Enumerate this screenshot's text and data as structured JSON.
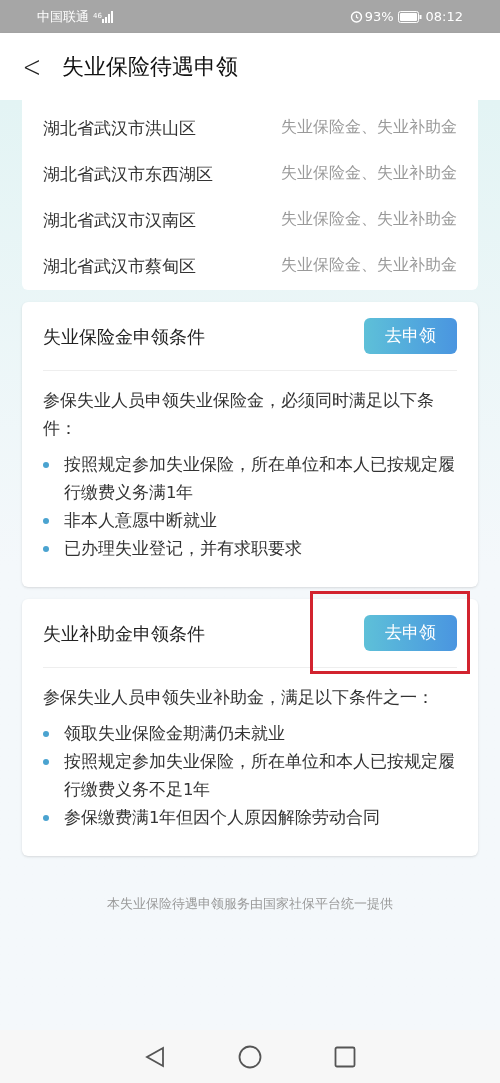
{
  "status_bar": {
    "carrier": "中国联通",
    "network": "46",
    "battery_percent": "93%",
    "time": "08:12"
  },
  "header": {
    "back": "<",
    "title": "失业保险待遇申领"
  },
  "regions": [
    {
      "area": "湖北省武汉市洪山区",
      "benefits": "失业保险金、失业补助金"
    },
    {
      "area": "湖北省武汉市东西湖区",
      "benefits": "失业保险金、失业补助金"
    },
    {
      "area": "湖北省武汉市汉南区",
      "benefits": "失业保险金、失业补助金"
    },
    {
      "area": "湖北省武汉市蔡甸区",
      "benefits": "失业保险金、失业补助金"
    }
  ],
  "cards": [
    {
      "title": "失业保险金申领条件",
      "button": "去申领",
      "highlighted": false,
      "intro": "参保失业人员申领失业保险金，必须同时满足以下条件：",
      "conditions": [
        "按照规定参加失业保险，所在单位和本人已按规定履行缴费义务满1年",
        "非本人意愿中断就业",
        "已办理失业登记，并有求职要求"
      ]
    },
    {
      "title": "失业补助金申领条件",
      "button": "去申领",
      "highlighted": true,
      "intro": "参保失业人员申领失业补助金，满足以下条件之一：",
      "conditions": [
        "领取失业保险金期满仍未就业",
        "按照规定参加失业保险，所在单位和本人已按规定履行缴费义务不足1年",
        "参保缴费满1年但因个人原因解除劳动合同"
      ]
    }
  ],
  "footer": "本失业保险待遇申领服务由国家社保平台统一提供"
}
